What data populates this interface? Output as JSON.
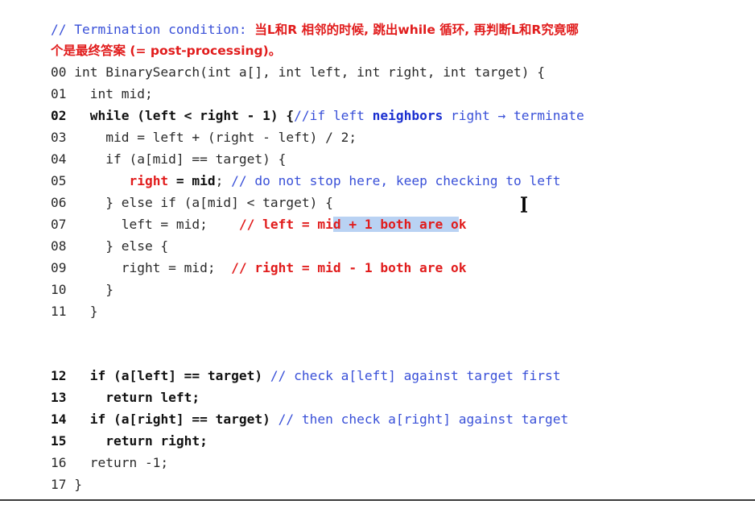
{
  "header": {
    "comment_prefix": "// Termination condition: ",
    "comment_cn_1": "当L和R 相邻的时候, 跳出while 循环, 再判断L和R究竟哪",
    "comment_cn_2": "个是最终答案 (= post-processing)。"
  },
  "code": {
    "l00": {
      "num": "00",
      "text": " int BinarySearch(int a[], int left, int right, int target) {"
    },
    "l01": {
      "num": "01",
      "text": "   int mid;"
    },
    "l02": {
      "num": "02",
      "code": "while (left < right - 1) {",
      "c1": "//if left ",
      "c2": "neighbors",
      "c3": " right → terminate"
    },
    "l03": {
      "num": "03",
      "text": "     mid = left + (right - left) / 2;"
    },
    "l04": {
      "num": "04",
      "text": "     if (a[mid] == target) {"
    },
    "l05": {
      "num": "05",
      "red": "right",
      "bold": " = mid",
      "rest": ";",
      "comment": " // do not stop here, keep checking to left"
    },
    "l06": {
      "num": "06",
      "text": "     } else if (a[mid] < target) {"
    },
    "l07": {
      "num": "07",
      "code": "       left = mid;    ",
      "r1": "// left = mi",
      "r_sel": "d + 1 both are o",
      "r2": "k"
    },
    "l08": {
      "num": "08",
      "text": "     } else {"
    },
    "l09": {
      "num": "09",
      "code": "       right = mid;  ",
      "red": "// right = mid - 1 both are ok"
    },
    "l10": {
      "num": "10",
      "text": "     }"
    },
    "l11": {
      "num": "11",
      "text": "   }"
    },
    "l12": {
      "num": "12",
      "bold": "if (a[left] == target)",
      "comment": " // check a[left] against target first"
    },
    "l13": {
      "num": "13",
      "bold": "return left;"
    },
    "l14": {
      "num": "14",
      "bold": "if (a[right] == target)",
      "comment": " // then check a[right] against target"
    },
    "l15": {
      "num": "15",
      "bold": "return right;"
    },
    "l16": {
      "num": "16",
      "text": "   return -1;"
    },
    "l17": {
      "num": "17",
      "text": " }"
    }
  },
  "colors": {
    "comment_blue": "#3950d8",
    "highlight_red": "#e11c1c",
    "selection": "#b9d2f3"
  }
}
